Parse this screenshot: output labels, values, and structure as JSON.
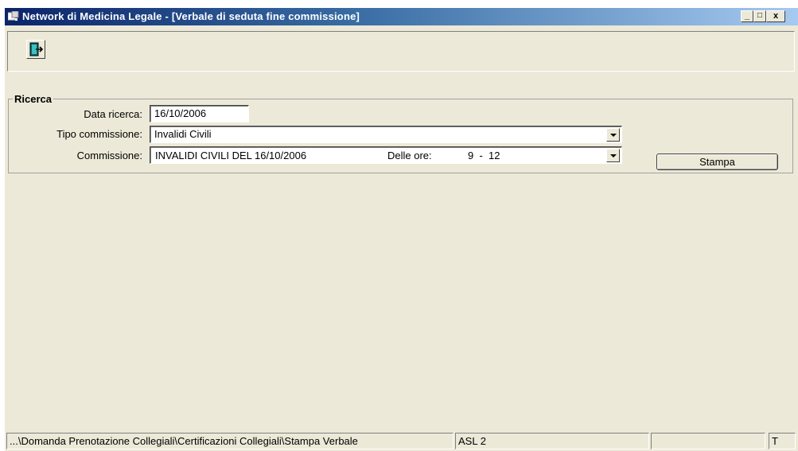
{
  "window": {
    "title": "Network di Medicina Legale - [Verbale di seduta fine commissione]",
    "controls": {
      "minimize": "_",
      "maximize": "□",
      "close": "x"
    }
  },
  "toolbar": {
    "exit_icon": "exit-door-icon"
  },
  "search": {
    "group_title": "Ricerca",
    "date_label": "Data ricerca:",
    "date_value": "16/10/2006",
    "type_label": "Tipo commissione:",
    "type_value": "Invalidi Civili",
    "commission_label": "Commissione:",
    "commission_name": "INVALIDI CIVILI DEL 16/10/2006",
    "hours_label": "Delle ore:",
    "hours_value": "9  -  12",
    "print_button": "Stampa"
  },
  "statusbar": {
    "path": "...\\Domanda Prenotazione Collegiali\\Certificazioni Collegiali\\Stampa Verbale",
    "asl": "ASL 2",
    "empty": "",
    "mode": "T"
  },
  "colors": {
    "titlebar_start": "#0b246a",
    "titlebar_end": "#a6caf0",
    "face": "#ece9d8"
  }
}
